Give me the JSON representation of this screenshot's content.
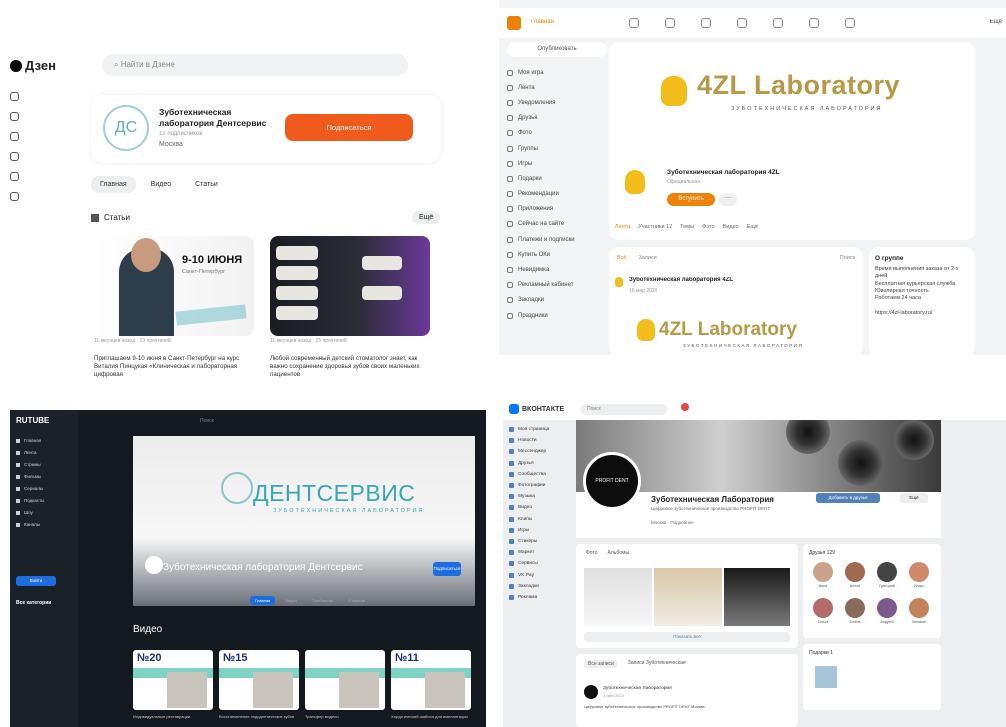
{
  "dzen": {
    "logo": "Дзен",
    "search_placeholder": "Найти в Дзене",
    "avatar_text": "ДС",
    "channel_title": "Зуботехническая лаборатория Дентсервис",
    "channel_subs": "12 подписчиков",
    "channel_city": "Москва",
    "subscribe": "Подписаться",
    "tabs": [
      "Главная",
      "Видео",
      "Статьи"
    ],
    "section": "Статьи",
    "all": "Ещё",
    "article1": {
      "date": "9-10 ИЮНЯ",
      "city": "Санкт-Петербург",
      "meta": "11 месяцев назад · 13 прочтений",
      "text": "Приглашаем 9-10 июня в Санкт-Петербург на курс Виталия Пинцукая «Клиническая и лабораторная цифровая"
    },
    "article2": {
      "meta": "11 месяцев назад · 25 прочтений",
      "text": "Любой современный детский стоматолог знает, как важно сохранение здоровья зубов своих маленьких пациентов"
    }
  },
  "ok": {
    "home": "Главная",
    "more": "Ещё",
    "publish": "Опубликовать",
    "menu": [
      "Моя игра",
      "Лента",
      "Уведомления",
      "Друзья",
      "Фото",
      "Группы",
      "Игры",
      "Подарки",
      "Рекомендации",
      "Приложения",
      "Сейчас на сайте",
      "Платежи и подписки",
      "Купить ОКи",
      "Невидимка",
      "Рекламный кабинет",
      "Закладки",
      "Праздники"
    ],
    "brand": "4ZL Laboratory",
    "brand_sub": "ЗУБОТЕХНИЧЕСКАЯ ЛАБОРАТОРИЯ",
    "group_name": "Зуботехническая лаборатория 4ZL",
    "group_type": "Официальная",
    "join": "Вступить",
    "dots": "···",
    "group_tabs": [
      "Лента",
      "Участники 12",
      "Темы",
      "Фото",
      "Видео",
      "Ещё"
    ],
    "feed_tabs": [
      "Всё",
      "Записи"
    ],
    "feed_search": "Поиск",
    "post_name": "Зуботехническая лаборатория 4ZL",
    "post_date": "16 мар 2020",
    "about_title": "О группе",
    "about_lines": [
      "Время выполнения заказа от 2-х дней",
      "Бесплатная курьерская служба",
      "Ювелирная точность",
      "Работаем 24 часа"
    ],
    "about_url": "https://4zl-laboratory.ru/"
  },
  "rutube": {
    "logo": "RUTUBE",
    "menu": [
      "Главная",
      "Лента",
      "Стримы",
      "Фильмы",
      "Сериалы",
      "Подкасты",
      "Шоу",
      "Каналы"
    ],
    "login": "Войти",
    "categories": "Все категории",
    "search": "Поиск",
    "brand": "ДЕНТСЕРВИС",
    "brand_sub": "ЗУБОТЕХНИЧЕСКАЯ ЛАБОРАТОРИЯ",
    "channel": "Зуботехническая лаборатория Дентсервис",
    "subscribe": "Подписаться",
    "tabs": [
      "Главная",
      "Видео",
      "Плейлисты",
      "О канале"
    ],
    "videos_title": "Видео",
    "videos": [
      {
        "num": "№20",
        "caption": "Индивидуальные реставрации"
      },
      {
        "num": "№15",
        "caption": "Восстановление эндодонтических зубов"
      },
      {
        "num": "",
        "caption": "Трансфер модели"
      },
      {
        "num": "№11",
        "caption": "Хирургический шаблон для имплантации"
      }
    ]
  },
  "vk": {
    "logo": "ВКОНТАКТЕ",
    "search": "Поиск",
    "menu": [
      "Моя страница",
      "Новости",
      "Мессенджер",
      "Друзья",
      "Сообщества",
      "Фотографии",
      "Музыка",
      "Видео",
      "Клипы",
      "Игры",
      "Стикеры",
      "Маркет",
      "Сервисы",
      "VK Pay",
      "Закладки",
      "Реклама"
    ],
    "avatar_text": "PROFIT DENT",
    "name": "Зуботехническая Лаборатория",
    "status": "Цифровое зуботехническое производство PROFIT DENT",
    "info": "Москва · Подробнее",
    "add": "Добавить в друзья",
    "more": "Ещё",
    "photo_tabs": [
      "Фото",
      "Альбомы"
    ],
    "show_all": "Показать всё",
    "friends_title": "Друзья 129",
    "friends": [
      "Анна",
      "Антон",
      "Григорий",
      "Игорь",
      "Ольга",
      "Елена",
      "Андрей",
      "Михаил"
    ],
    "pods_title": "Подарки 1",
    "wall_tabs": [
      "Все записи",
      "Записи Зуботехническая"
    ],
    "wall_name": "Зуботехническая Лаборатория",
    "wall_date": "4 июн 2023",
    "wall_text": "Цифровое зуботехническое производство PROFIT DENT Москва"
  }
}
